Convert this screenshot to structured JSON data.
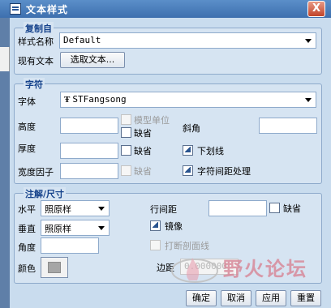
{
  "window": {
    "title": "文本样式",
    "close_glyph": "X"
  },
  "groups": {
    "copy_from": {
      "label": "复制自",
      "style_name_label": "样式名称",
      "style_name_value": "Default",
      "existing_text_label": "现有文本",
      "select_text_button": "选取文本..."
    },
    "character": {
      "label": "字符",
      "font_label": "字体",
      "font_value": "STFangsong",
      "height_label": "高度",
      "model_units_label": "模型单位",
      "default_label_1": "缺省",
      "slant_label": "斜角",
      "thickness_label": "厚度",
      "default_label_2": "缺省",
      "underline_label": "下划线",
      "width_factor_label": "宽度因子",
      "default_label_3": "缺省",
      "char_spacing_label": "字符间距处理"
    },
    "note_dimension": {
      "label": "注解/尺寸",
      "horizontal_label": "水平",
      "horizontal_value": "照原样",
      "line_spacing_label": "行间距",
      "default_label": "缺省",
      "vertical_label": "垂直",
      "vertical_value": "照原样",
      "mirror_label": "镜像",
      "angle_label": "角度",
      "break_hatch_label": "打断剖面线",
      "color_label": "颜色",
      "margin_label": "边距",
      "margin_value": "0.000000"
    }
  },
  "buttons": {
    "ok": "确定",
    "cancel": "取消",
    "apply": "应用",
    "reset": "重置"
  },
  "watermark": {
    "text": "野火论坛"
  },
  "colors": {
    "title_bar": "#3d6fae",
    "group_label": "#15428b",
    "color_swatch": "#a6a6a6"
  },
  "icons": [
    "dialog-icon",
    "close-icon",
    "font-type-icon",
    "dropdown-arrow-icon",
    "color-swatch-icon"
  ]
}
